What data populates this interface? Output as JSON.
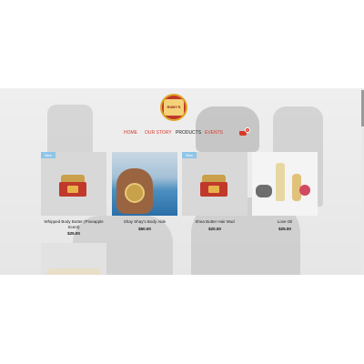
{
  "header": {
    "logo_text": "RUBY'S",
    "nav": {
      "home": "HOME",
      "our_story": "OUR STORY",
      "products": "PRODUCTS",
      "events": "EVENTS"
    },
    "cart_count": "0"
  },
  "products": [
    {
      "badge": "New",
      "name": "Whipped Body Butter (Pineapple Scent)",
      "price": "$25.00"
    },
    {
      "badge": "",
      "name": "Shay Shay's Body Aide",
      "price": "$50.00"
    },
    {
      "badge": "New",
      "name": "Shea Butter Hair Mud",
      "price": "$20.00"
    },
    {
      "badge": "",
      "name": "Love Oil",
      "price": "$25.00"
    }
  ],
  "colors": {
    "accent": "#d63a2b",
    "badge": "#8ec5e8",
    "gold": "#c9a14a"
  },
  "icons": {
    "cart": "cart-icon",
    "logo": "ruby-logo-icon"
  }
}
